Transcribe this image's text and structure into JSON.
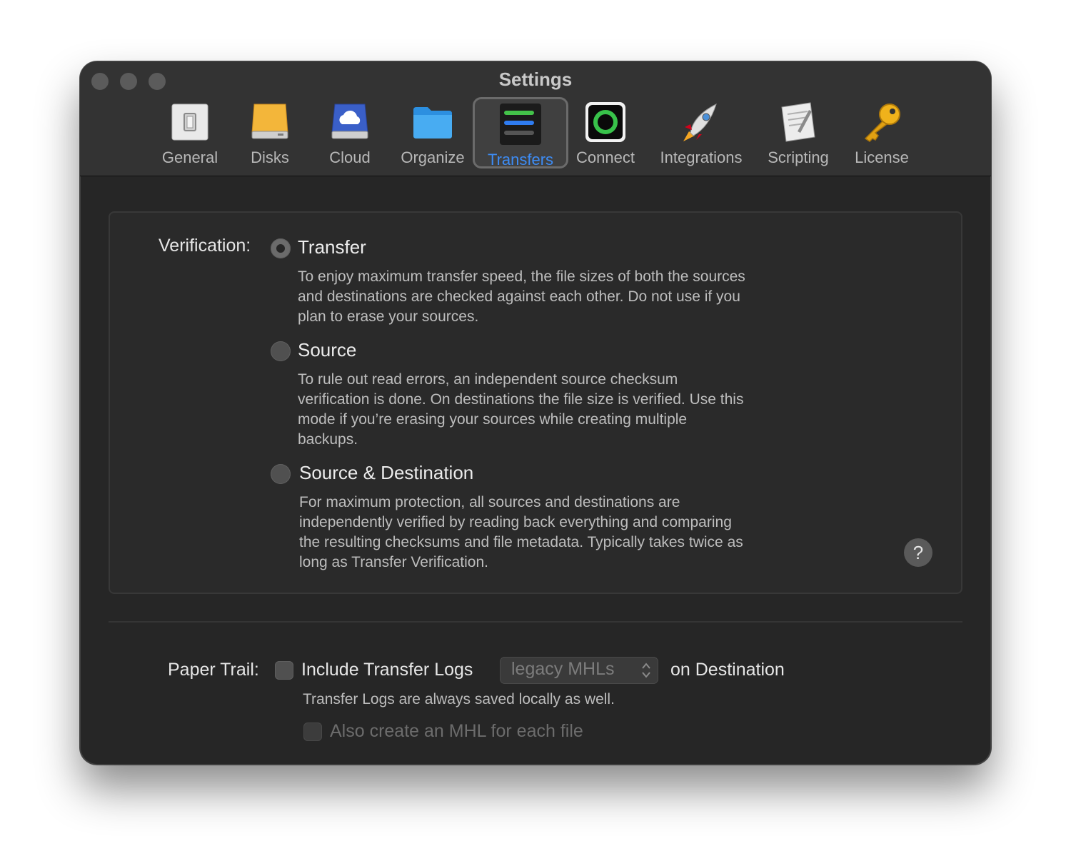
{
  "window": {
    "title": "Settings"
  },
  "toolbar": {
    "tabs": [
      {
        "label": "General",
        "icon": "switch-icon"
      },
      {
        "label": "Disks",
        "icon": "disk-icon"
      },
      {
        "label": "Cloud",
        "icon": "cloud-drive-icon"
      },
      {
        "label": "Organize",
        "icon": "folder-icon"
      },
      {
        "label": "Transfers",
        "icon": "transfers-icon",
        "selected": true
      },
      {
        "label": "Connect",
        "icon": "connect-ring-icon"
      },
      {
        "label": "Integrations",
        "icon": "rocket-icon"
      },
      {
        "label": "Scripting",
        "icon": "script-icon"
      },
      {
        "label": "License",
        "icon": "key-icon"
      }
    ]
  },
  "verification": {
    "label": "Verification:",
    "options": [
      {
        "title": "Transfer",
        "selected": true,
        "description": [
          "To enjoy maximum transfer speed, the file sizes of both the sources",
          "and destinations are checked against each other. Do not use if you",
          "plan to erase your sources."
        ]
      },
      {
        "title": "Source",
        "selected": false,
        "description": [
          "To rule out read errors, an independent source checksum",
          "verification is done. On destinations the file size is verified. Use this",
          "mode if you’re erasing your sources while creating multiple",
          "backups."
        ]
      },
      {
        "title": "Source & Destination",
        "selected": false,
        "description": [
          "For maximum protection, all sources and destinations are",
          "independently verified by reading back everything and comparing",
          "the resulting checksums and file metadata. Typically takes twice as",
          "long as Transfer Verification."
        ]
      }
    ],
    "help": "?"
  },
  "paper_trail": {
    "label": "Paper Trail:",
    "include_logs_label": "Include Transfer Logs",
    "include_logs_checked": false,
    "format_value": "legacy MHLs",
    "suffix": "on Destination",
    "note": "Transfer Logs are always saved locally as well.",
    "mhl_each_file_label": "Also create an MHL for each file",
    "mhl_each_file_checked": false
  },
  "colors": {
    "accent": "#3d8cf5",
    "window_bg": "#262626",
    "titlebar_bg": "#333333"
  }
}
